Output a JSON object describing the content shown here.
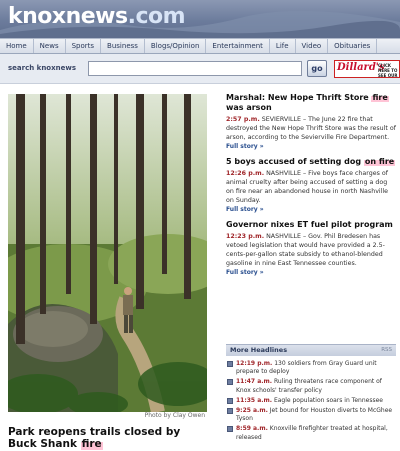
{
  "site": {
    "logo_name": "knoxnews",
    "logo_tld": ".com"
  },
  "nav": {
    "items": [
      "Home",
      "News",
      "Sports",
      "Business",
      "Blogs/Opinion",
      "Entertainment",
      "Life",
      "Video",
      "Obituaries"
    ]
  },
  "search": {
    "label": "search knoxnews",
    "value": "",
    "go_label": "go"
  },
  "ad": {
    "brand": "Dillard's",
    "cta": "CLICK HERE TO SEE OUR"
  },
  "photo": {
    "credit": "Photo by Clay Owen"
  },
  "main_story": {
    "headline_pre": "Park reopens trails closed by Buck Shank ",
    "headline_hl": "fire"
  },
  "stories": [
    {
      "title_pre": "Marshal: New Hope Thrift Store ",
      "title_hl": "fire",
      "title_post": " was arson",
      "time": "2:57 p.m.",
      "body": " SEVIERVILLE – The June 22 fire that destroyed the New Hope Thrift Store was the result of arson, according to the Sevierville Fire Department.",
      "more": "Full story »"
    },
    {
      "title_pre": "5 boys accused of setting dog ",
      "title_hl": "on fire",
      "title_post": "",
      "time": "12:26 p.m.",
      "body": " NASHVILLE – Five boys face charges of animal cruelty after being accused of setting a dog on fire near an abandoned house in north Nashville on Sunday.",
      "more": "Full story »"
    },
    {
      "title_pre": "Governor nixes ET fuel pilot program",
      "title_hl": "",
      "title_post": "",
      "time": "12:23 p.m.",
      "body": " NASHVILLE – Gov. Phil Bredesen has vetoed legislation that would have provided a 2.5-cents-per-gallon state subsidy to ethanol-blended gasoline in nine East Tennessee counties.",
      "more": "Full story »"
    }
  ],
  "more_headlines": {
    "title": "More Headlines",
    "rss": "RSS",
    "items": [
      {
        "time": "12:19 p.m.",
        "text": " 130 soldiers from Gray Guard unit prepare to deploy"
      },
      {
        "time": "11:47 a.m.",
        "text": " Ruling threatens race component of Knox schools' transfer policy"
      },
      {
        "time": "11:35 a.m.",
        "text": " Eagle population soars in Tennessee"
      },
      {
        "time": "9:25 a.m.",
        "text": " Jet bound for Houston diverts to McGhee Tyson"
      },
      {
        "time": "8:59 a.m.",
        "text": " Knoxville firefighter treated at hospital, released"
      }
    ]
  },
  "colors": {
    "accent_time": "#a0262a",
    "link": "#2a4f8f",
    "highlight": "#ffc4d6",
    "header": "#6c7c9c"
  }
}
